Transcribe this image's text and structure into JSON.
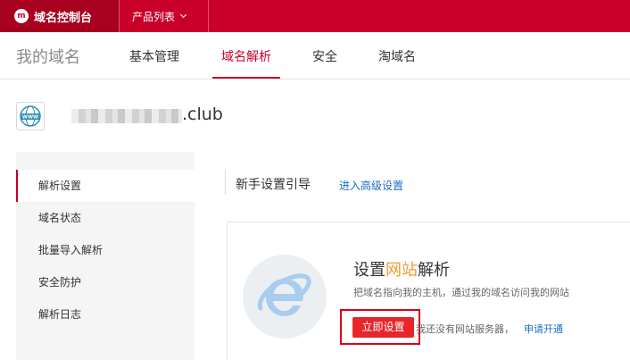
{
  "topbar": {
    "brand_title": "域名控制台",
    "brand_logo_text": "m",
    "product_menu": "产品列表"
  },
  "nav": {
    "title": "我的域名",
    "tabs": [
      {
        "label": "基本管理",
        "active": false
      },
      {
        "label": "域名解析",
        "active": true
      },
      {
        "label": "安全",
        "active": false
      },
      {
        "label": "淘域名",
        "active": false
      }
    ]
  },
  "domain": {
    "icon": "www-globe-icon",
    "icon_text": "WWW",
    "suffix": ".club"
  },
  "sidebar": {
    "items": [
      {
        "label": "解析设置",
        "active": true
      },
      {
        "label": "域名状态",
        "active": false
      },
      {
        "label": "批量导入解析",
        "active": false
      },
      {
        "label": "安全防护",
        "active": false
      },
      {
        "label": "解析日志",
        "active": false
      }
    ]
  },
  "main": {
    "guide_title": "新手设置引导",
    "advanced_link": "进入高级设置",
    "card": {
      "title_part1": "设置",
      "title_highlight": "网站",
      "title_part2": "解析",
      "description": "把域名指向我的主机，通过我的域名访问我的网站",
      "setup_button": "立即设置",
      "no_server_text": "我还没有网站服务器，",
      "apply_link": "申请开通"
    }
  },
  "colors": {
    "brand_red": "#c8002a",
    "highlight_orange": "#f29a2e",
    "link_blue": "#1a6fc2",
    "button_red": "#e8262a"
  }
}
